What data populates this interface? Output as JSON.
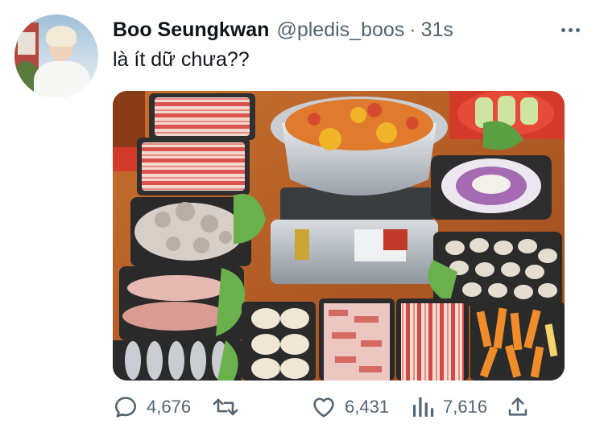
{
  "tweet": {
    "author_name": "Boo Seungkwan",
    "handle": "@pledis_boos",
    "separator": "·",
    "time": "31s",
    "text": "là ít dữ chưa??"
  },
  "actions": {
    "replies": "4,676",
    "retweets": "",
    "likes": "6,431",
    "views": "7,616"
  },
  "icons": {
    "more": "more-horizontal-icon",
    "reply": "reply-icon",
    "retweet": "retweet-icon",
    "like": "heart-icon",
    "views": "views-bar-chart-icon",
    "share": "share-icon"
  },
  "colors": {
    "text_primary": "#0f1419",
    "text_secondary": "#536471",
    "background": "#ffffff"
  }
}
